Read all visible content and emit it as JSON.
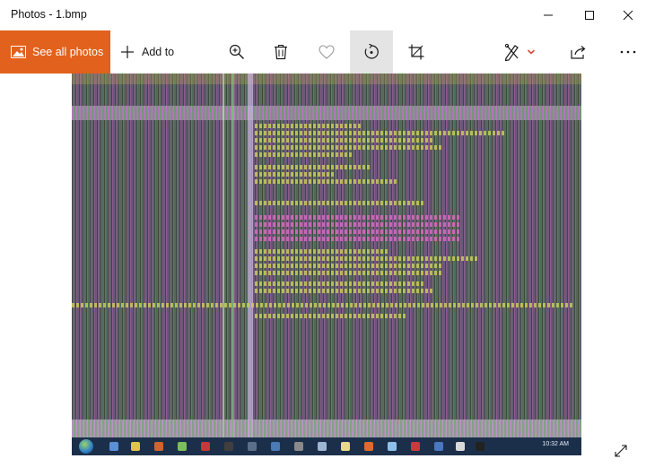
{
  "window": {
    "title": "Photos - 1.bmp"
  },
  "commandbar": {
    "see_all_photos": "See all photos",
    "add_to": "Add to"
  },
  "photo": {
    "taskbar_clock": "10:32 AM"
  },
  "colors": {
    "accent": "#e2611c",
    "active_tool_bg": "#e4e4e4",
    "dropdown_chevron": "#d84a3a"
  },
  "icons": {
    "minimize": "minimize-icon",
    "maximize": "maximize-icon",
    "close": "close-icon",
    "photos": "photo-icon",
    "add": "plus-icon",
    "zoom": "zoom-in-icon",
    "delete": "trash-icon",
    "favorite": "heart-icon",
    "rotate": "rotate-icon",
    "crop": "crop-icon",
    "edit_create": "draw-icon",
    "share": "share-icon",
    "more": "more-icon",
    "fullscreen": "expand-icon"
  }
}
